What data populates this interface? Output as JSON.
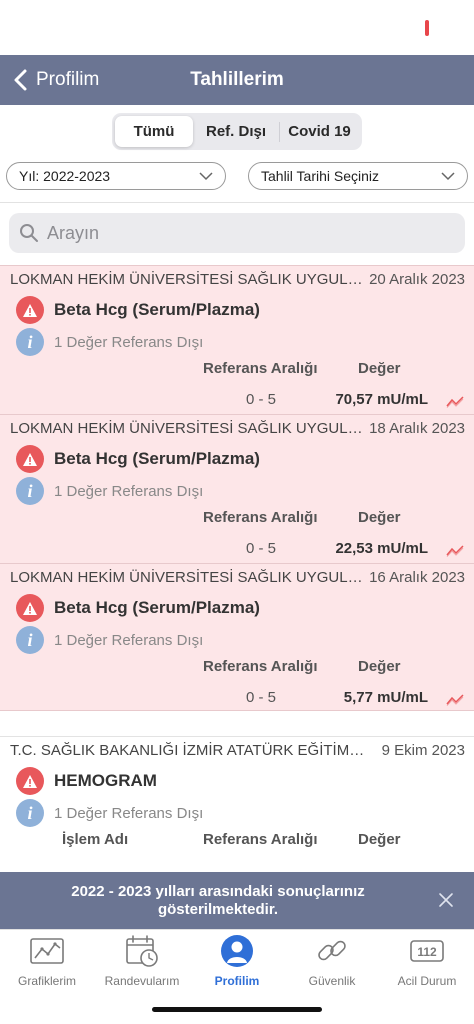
{
  "navbar": {
    "back_label": "Profilim",
    "title": "Tahlillerim"
  },
  "segments": [
    "Tümü",
    "Ref. Dışı",
    "Covid 19"
  ],
  "filters": {
    "year": "Yıl: 2022-2023",
    "date": "Tahlil Tarihi Seçiniz"
  },
  "search": {
    "placeholder": "Arayın"
  },
  "results": [
    {
      "institution": "LOKMAN HEKİM ÜNİVERSİTESİ SAĞLIK UYGULAM...",
      "date": "20 Aralık 2023",
      "test": "Beta Hcg (Serum/Plazma)",
      "info": "1 Değer Referans Dışı",
      "col_ref": "Referans Aralığı",
      "col_val": "Değer",
      "range": "0 - 5",
      "value": "70,57 mU/mL"
    },
    {
      "institution": "LOKMAN HEKİM ÜNİVERSİTESİ SAĞLIK UYGULAM...",
      "date": "18 Aralık 2023",
      "test": "Beta Hcg (Serum/Plazma)",
      "info": "1 Değer Referans Dışı",
      "col_ref": "Referans Aralığı",
      "col_val": "Değer",
      "range": "0 - 5",
      "value": "22,53 mU/mL"
    },
    {
      "institution": "LOKMAN HEKİM ÜNİVERSİTESİ SAĞLIK UYGULAM...",
      "date": "16 Aralık 2023",
      "test": "Beta Hcg (Serum/Plazma)",
      "info": "1 Değer Referans Dışı",
      "col_ref": "Referans Aralığı",
      "col_val": "Değer",
      "range": "0 - 5",
      "value": "5,77 mU/mL"
    },
    {
      "institution": "T.C. SAĞLIK BAKANLIĞI İZMİR ATATÜRK EĞİTİM VE...",
      "date": "9 Ekim 2023",
      "test": "HEMOGRAM",
      "info": "1 Değer Referans Dışı",
      "col_name": "İşlem Adı",
      "col_ref": "Referans Aralığı",
      "col_val": "Değer"
    }
  ],
  "banner": {
    "text": "2022 - 2023 yılları arasındaki sonuçlarınız gösterilmektedir."
  },
  "tabs": [
    {
      "label": "Grafiklerim",
      "icon": "chart-icon"
    },
    {
      "label": "Randevularım",
      "icon": "calendar-clock-icon"
    },
    {
      "label": "Profilim",
      "icon": "person-icon"
    },
    {
      "label": "Güvenlik",
      "icon": "link-icon"
    },
    {
      "label": "Acil Durum",
      "icon": "emergency-112-icon",
      "icon_text": "112"
    }
  ],
  "colors": {
    "nav": "#6b7593",
    "abnormal_card": "#fde6e8",
    "warning": "#e8585b",
    "info": "#8fb1d9",
    "active_tab": "#2f6fd7"
  }
}
